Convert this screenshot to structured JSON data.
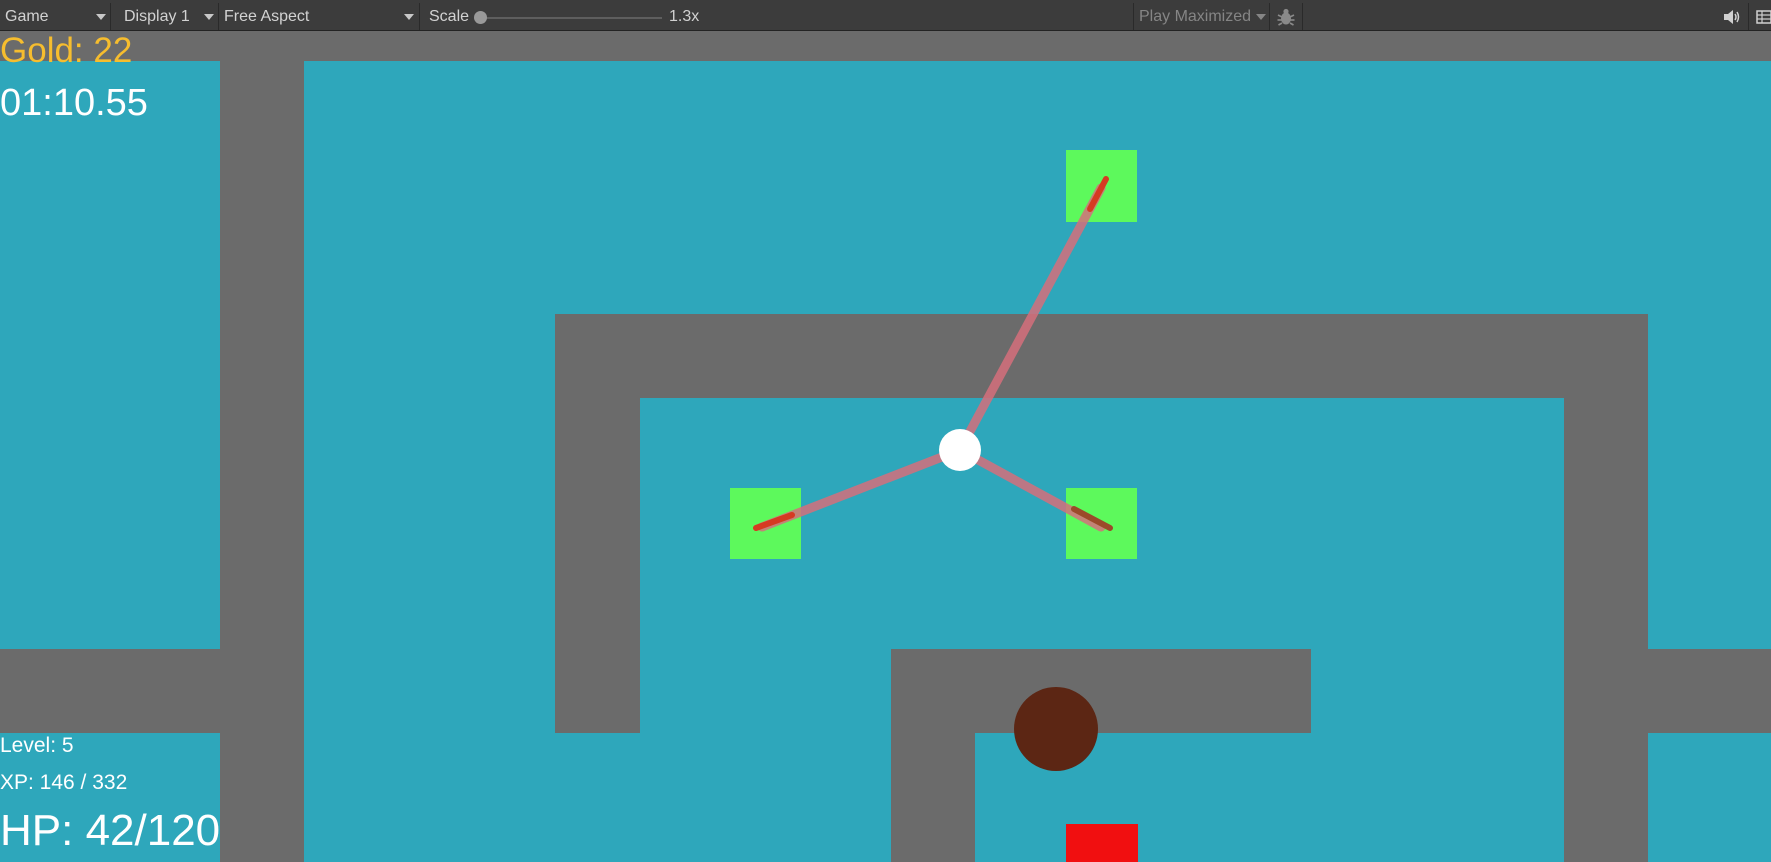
{
  "toolbar": {
    "view_mode": "Game",
    "display": "Display 1",
    "aspect": "Free Aspect",
    "scale_label": "Scale",
    "scale_value": "1.3x",
    "play_mode": "Play Maximized",
    "icons": [
      "bug-icon",
      "speaker-icon",
      "stats-icon"
    ]
  },
  "hud": {
    "gold": "Gold: 22",
    "timer": "01:10.55",
    "level": "Level: 5",
    "xp": "XP: 146 / 332",
    "hp": "HP: 42/120"
  },
  "colors": {
    "floor": "#2ea7bb",
    "wall": "#6b6b6b",
    "enemy": "#5df95c",
    "beam": "#d56f7b",
    "gold_text": "#f6bd2e",
    "player": "#ffffff",
    "hazard": "#f10f10",
    "blob": "#5c2614"
  }
}
